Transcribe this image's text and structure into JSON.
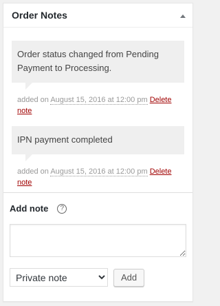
{
  "panel": {
    "title": "Order Notes",
    "toggle_icon": "triangle-up-icon"
  },
  "notes": [
    {
      "content": "Order status changed from Pending Payment to Processing.",
      "meta_prefix": "added on",
      "date": "August 15, 2016 at 12:00 pm",
      "delete_label": "Delete note"
    },
    {
      "content": "IPN payment completed",
      "meta_prefix": "added on",
      "date": "August 15, 2016 at 12:00 pm",
      "delete_label": "Delete note"
    }
  ],
  "add_note": {
    "label": "Add note",
    "help_icon": "question-circle-icon",
    "help_glyph": "?",
    "textarea_value": "",
    "type_selected": "Private note",
    "type_options": [
      "Private note"
    ],
    "add_button_label": "Add"
  },
  "colors": {
    "delete_link": "#a00000",
    "note_bg": "#efefef",
    "page_bg": "#f1f1f1"
  }
}
